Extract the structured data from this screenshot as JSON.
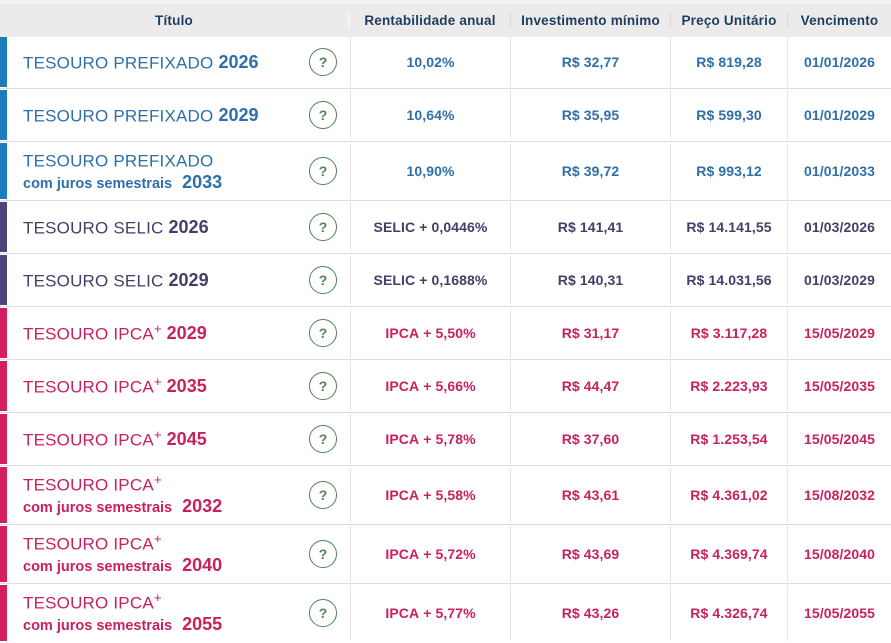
{
  "colors": {
    "prefixado_bar": "#1E7BBC",
    "prefixado_text": "#2E6FA9",
    "selic_bar": "#4D4376",
    "selic_text": "#453E68",
    "ipca_bar": "#D31E62",
    "ipca_text": "#C9205E",
    "help_green": "#4E8656",
    "header_bg": "#ECEAEA",
    "header_text": "#1C3D5E"
  },
  "table": {
    "columns": [
      "Título",
      "Rentabilidade anual",
      "Investimento mínimo",
      "Preço Unitário",
      "Vencimento"
    ],
    "help_glyph": "?",
    "rows": [
      {
        "type": "prefixado",
        "name": "TESOURO PREFIXADO",
        "sup": "",
        "subtitle": "",
        "year": "2026",
        "rate_label": "",
        "rate_rest": "10,02%",
        "min_investment": "R$ 32,77",
        "unit_price": "R$ 819,28",
        "maturity": "01/01/2026"
      },
      {
        "type": "prefixado",
        "name": "TESOURO PREFIXADO",
        "sup": "",
        "subtitle": "",
        "year": "2029",
        "rate_label": "",
        "rate_rest": "10,64%",
        "min_investment": "R$ 35,95",
        "unit_price": "R$ 599,30",
        "maturity": "01/01/2029"
      },
      {
        "type": "prefixado",
        "name": "TESOURO PREFIXADO",
        "sup": "",
        "subtitle": "com juros semestrais",
        "year": "2033",
        "rate_label": "",
        "rate_rest": "10,90%",
        "min_investment": "R$ 39,72",
        "unit_price": "R$ 993,12",
        "maturity": "01/01/2033"
      },
      {
        "type": "selic",
        "name": "TESOURO SELIC",
        "sup": "",
        "subtitle": "",
        "year": "2026",
        "rate_label": "SELIC",
        "rate_rest": " + 0,0446%",
        "min_investment": "R$ 141,41",
        "unit_price": "R$ 14.141,55",
        "maturity": "01/03/2026"
      },
      {
        "type": "selic",
        "name": "TESOURO SELIC",
        "sup": "",
        "subtitle": "",
        "year": "2029",
        "rate_label": "SELIC",
        "rate_rest": " + 0,1688%",
        "min_investment": "R$ 140,31",
        "unit_price": "R$ 14.031,56",
        "maturity": "01/03/2029"
      },
      {
        "type": "ipca",
        "name": "TESOURO IPCA",
        "sup": "+",
        "subtitle": "",
        "year": "2029",
        "rate_label": "IPCA",
        "rate_rest": " + 5,50%",
        "min_investment": "R$ 31,17",
        "unit_price": "R$ 3.117,28",
        "maturity": "15/05/2029"
      },
      {
        "type": "ipca",
        "name": "TESOURO IPCA",
        "sup": "+",
        "subtitle": "",
        "year": "2035",
        "rate_label": "IPCA",
        "rate_rest": " + 5,66%",
        "min_investment": "R$ 44,47",
        "unit_price": "R$ 2.223,93",
        "maturity": "15/05/2035"
      },
      {
        "type": "ipca",
        "name": "TESOURO IPCA",
        "sup": "+",
        "subtitle": "",
        "year": "2045",
        "rate_label": "IPCA",
        "rate_rest": " + 5,78%",
        "min_investment": "R$ 37,60",
        "unit_price": "R$ 1.253,54",
        "maturity": "15/05/2045"
      },
      {
        "type": "ipca",
        "name": "TESOURO IPCA",
        "sup": "+",
        "subtitle": "com juros semestrais",
        "year": "2032",
        "rate_label": "IPCA",
        "rate_rest": " + 5,58%",
        "min_investment": "R$ 43,61",
        "unit_price": "R$ 4.361,02",
        "maturity": "15/08/2032"
      },
      {
        "type": "ipca",
        "name": "TESOURO IPCA",
        "sup": "+",
        "subtitle": "com juros semestrais",
        "year": "2040",
        "rate_label": "IPCA",
        "rate_rest": " + 5,72%",
        "min_investment": "R$ 43,69",
        "unit_price": "R$ 4.369,74",
        "maturity": "15/08/2040"
      },
      {
        "type": "ipca",
        "name": "TESOURO IPCA",
        "sup": "+",
        "subtitle": "com juros semestrais",
        "year": "2055",
        "rate_label": "IPCA",
        "rate_rest": " + 5,77%",
        "min_investment": "R$ 43,26",
        "unit_price": "R$ 4.326,74",
        "maturity": "15/05/2055"
      }
    ]
  }
}
